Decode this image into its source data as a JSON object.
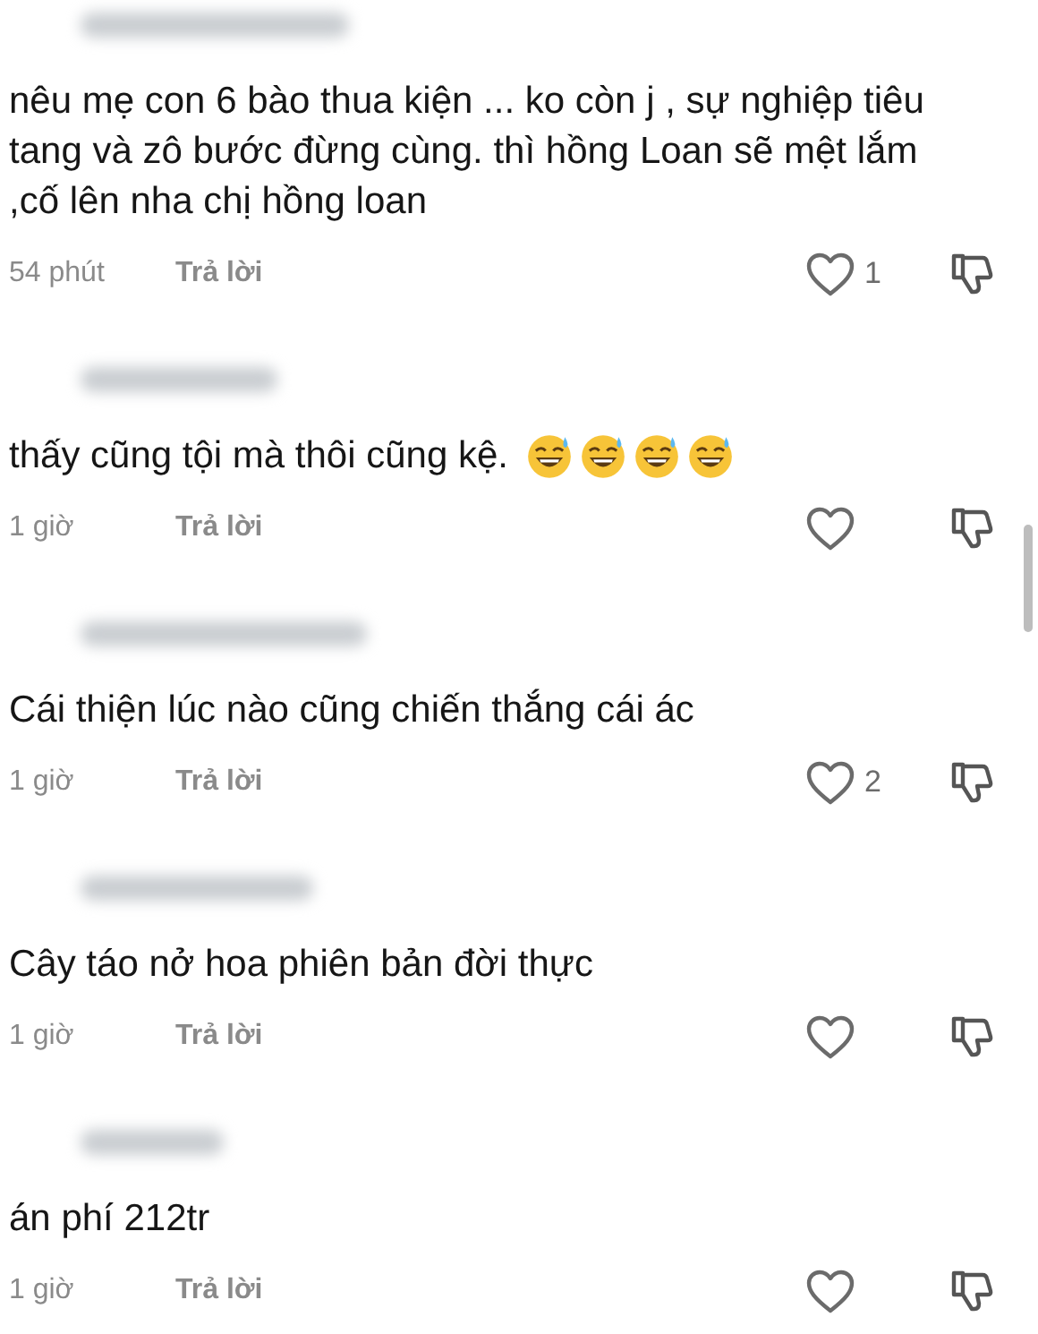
{
  "comments": [
    {
      "author": {
        "blurred": true
      },
      "text": "nêu mẹ con 6 bào thua kiện ... ko còn j , sự nghiệp tiêu tang và zô bước đừng cùng. thì hồng Loan sẽ mệt lắm ,cố lên nha chị hồng loan",
      "time": "54 phút",
      "reply": "Trả lời",
      "liked": false,
      "like_count": "1"
    },
    {
      "author": {
        "blurred": true
      },
      "text": "thấy cũng tội mà thôi cũng kệ.",
      "reactions": [
        {
          "kind": "sweat-smile"
        },
        {
          "kind": "sweat-smile"
        },
        {
          "kind": "sweat-smile"
        },
        {
          "kind": "sweat-smile"
        }
      ],
      "time": "1 giờ",
      "reply": "Trả lời",
      "liked": false
    },
    {
      "author": {
        "blurred": true
      },
      "text": "Cái thiện lúc nào cũng chiến thắng cái ác",
      "time": "1 giờ",
      "reply": "Trả lời",
      "liked": false,
      "like_count": "2"
    },
    {
      "author": {
        "blurred": true
      },
      "text": "Cây táo nở hoa phiên bản đời thực",
      "time": "1 giờ",
      "reply": "Trả lời",
      "liked": false
    },
    {
      "author": {
        "blurred": true
      },
      "text": "án phí 212tr",
      "time": "1 giờ",
      "reply": "Trả lời",
      "liked": false
    }
  ]
}
